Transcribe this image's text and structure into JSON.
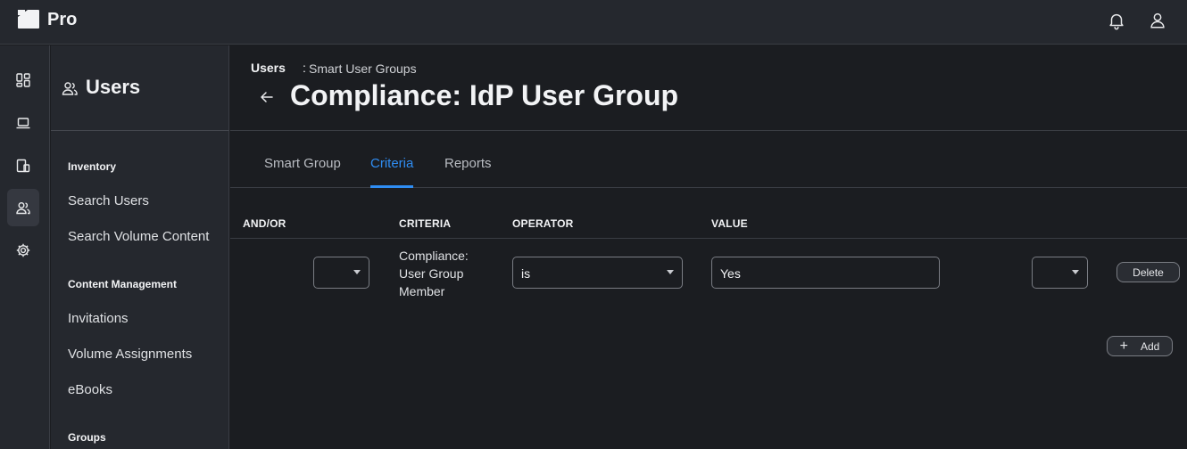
{
  "app": {
    "brand": "Pro"
  },
  "topbar": {
    "icons": [
      "bell-icon",
      "user-icon"
    ]
  },
  "rail": {
    "items": [
      "dashboard-icon",
      "laptop-icon",
      "devices-icon",
      "users-icon",
      "gear-icon"
    ],
    "active": "users-icon"
  },
  "sidebar": {
    "title": "Users",
    "sections": [
      {
        "label": "Inventory",
        "items": [
          "Search Users",
          "Search Volume Content"
        ]
      },
      {
        "label": "Content Management",
        "items": [
          "Invitations",
          "Volume Assignments",
          "eBooks"
        ]
      },
      {
        "label": "Groups",
        "items": []
      }
    ]
  },
  "breadcrumb": {
    "root": "Users",
    "separator": ":",
    "leaf": "Smart User Groups"
  },
  "page": {
    "title": "Compliance: IdP User Group"
  },
  "tabs": [
    {
      "label": "Smart Group",
      "active": false
    },
    {
      "label": "Criteria",
      "active": true
    },
    {
      "label": "Reports",
      "active": false
    }
  ],
  "table": {
    "headers": {
      "and_or": "AND/OR",
      "criteria": "CRITERIA",
      "operator": "OPERATOR",
      "value": "VALUE"
    },
    "rows": [
      {
        "and_or": "",
        "criteria": "Compliance: User Group Member",
        "operator": "is",
        "value": "Yes",
        "paren": "",
        "delete_label": "Delete"
      }
    ]
  },
  "actions": {
    "add_label": "Add"
  },
  "colors": {
    "accent": "#2f8df3",
    "background": "#1b1d21",
    "panel": "#25282e"
  }
}
